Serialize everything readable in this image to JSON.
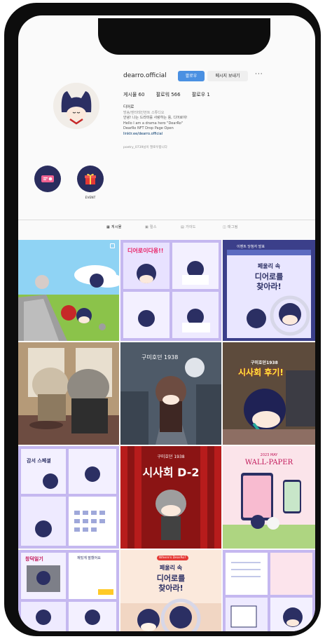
{
  "profile": {
    "username": "dearro.official",
    "follow_label": "팔로우",
    "message_label": "메시지 보내기",
    "more_label": "···",
    "stats": {
      "posts": "게시물 60",
      "followers": "팔로워 566",
      "following": "팔로우 1"
    },
    "bio": {
      "name": "디어로",
      "category": "방송/엔터테인먼트 스튜디오",
      "line1": "안녕! 나는 드라마를 사랑하는 용, 디어로야!",
      "line2": "Hello I am a drama hero \"DearRo\"",
      "line3": "DearRo NFT Drop Page Open",
      "link": "linktr.ee/dearro.official"
    },
    "followed_by": "poetry_0739님이 팔로우합니다"
  },
  "highlights": [
    {
      "label": ""
    },
    {
      "label": "EVENT"
    }
  ],
  "tabs": [
    {
      "label": "게시물"
    },
    {
      "label": "릴스"
    },
    {
      "label": "가이드"
    },
    {
      "label": "태그됨"
    }
  ],
  "posts": {
    "p3_header": "이벤트 당첨자 발표",
    "p3_title1": "페울리 속",
    "p3_title2": "디어로를",
    "p3_title3": "찾아라!",
    "p2_title": "디어로이다옹!!",
    "p5_title": "구미호던 1938",
    "p6_sub": "구미호던1938",
    "p6_title": "시사회 후기!",
    "p7_title": "감서 스페셜",
    "p8_sub": "구미호던 1938",
    "p8_title": "시사회 D-2",
    "p9_sub": "2023 MAY",
    "p9_title": "WALL-PAPER",
    "p10_title": "창덕일기",
    "p10_sub": "재밌게 말했어요",
    "p11_sub": "Where's DearRo?",
    "p11_title1": "페울리 속",
    "p11_title2": "디어로를",
    "p11_title3": "찾아라!"
  },
  "colors": {
    "follow_blue": "#4a90e2",
    "highlight_navy": "#2a2d5e",
    "character_navy": "#2b2f63"
  },
  "icons": [
    "more-icon",
    "ticket-icon",
    "gift-icon",
    "grid-icon",
    "reels-icon",
    "guide-icon",
    "tag-icon",
    "multi-post-icon"
  ]
}
